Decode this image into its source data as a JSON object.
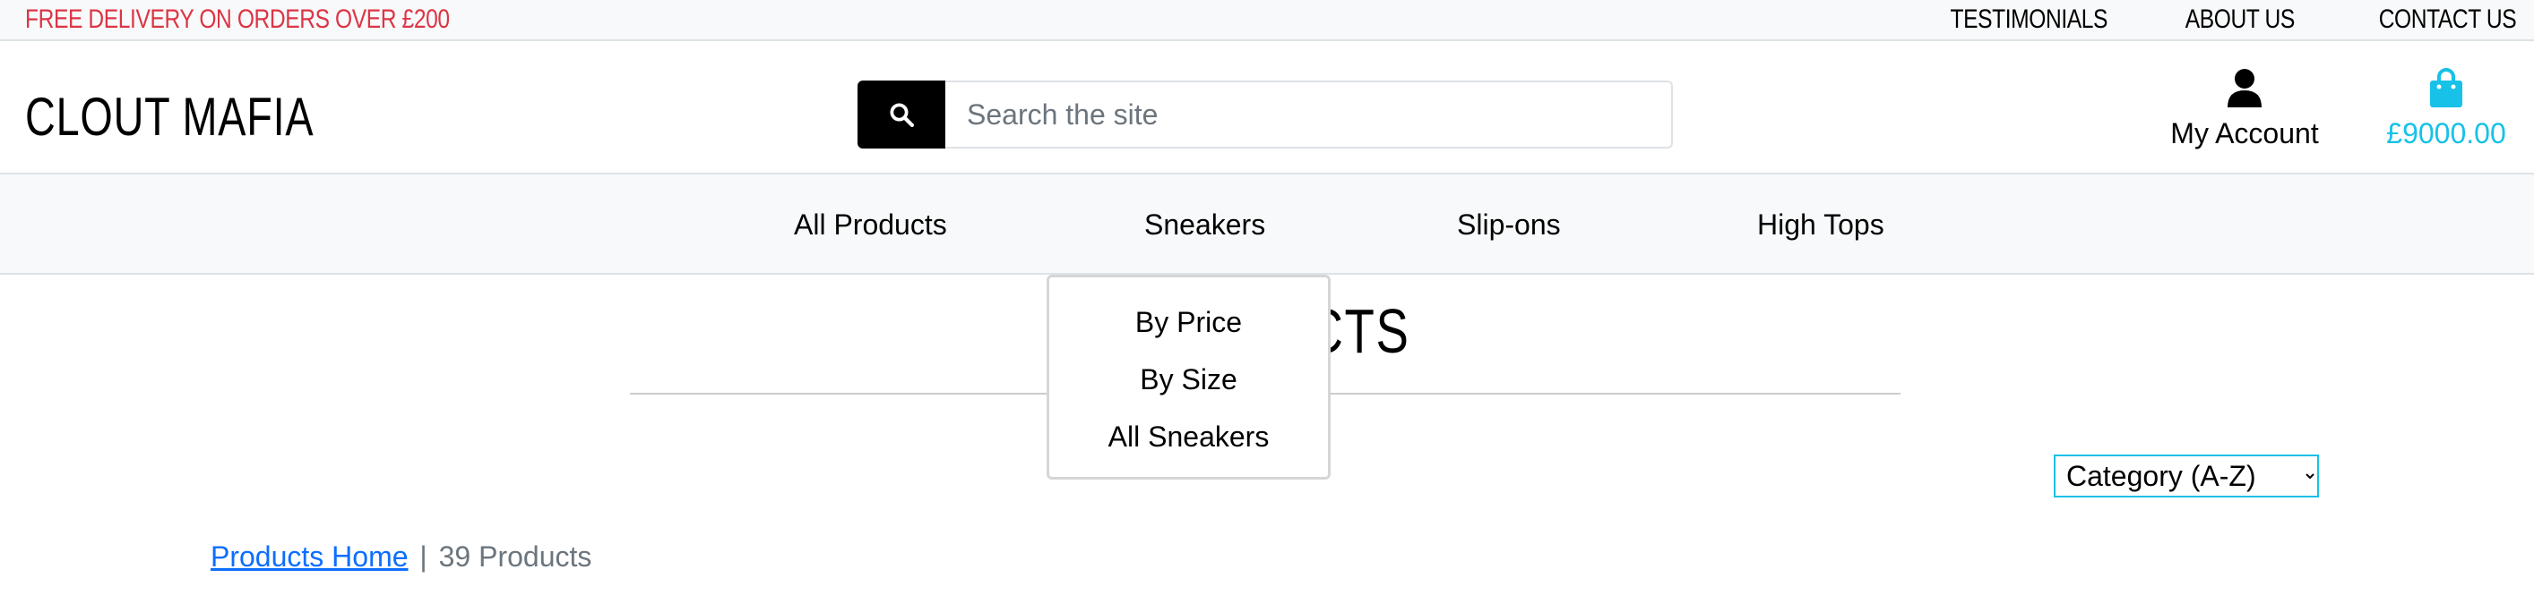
{
  "topbar": {
    "promo": "FREE DELIVERY ON ORDERS OVER £200",
    "links": [
      "TESTIMONIALS",
      "ABOUT US",
      "CONTACT US"
    ]
  },
  "header": {
    "logo": "CLOUT MAFIA",
    "search": {
      "placeholder": "Search the site",
      "icon": "search-icon"
    },
    "account": {
      "label": "My Account",
      "icon": "user-icon"
    },
    "cart": {
      "label": "£9000.00",
      "icon": "shopping-bag-icon",
      "color": "#17c1e8"
    }
  },
  "nav": {
    "items": [
      "All Products",
      "Sneakers",
      "Slip-ons",
      "High Tops"
    ]
  },
  "dropdown": {
    "items": [
      "By Price",
      "By Size",
      "All Sneakers"
    ]
  },
  "page": {
    "title": "PRODUCTS",
    "sort_selected": "Category (A-Z)",
    "breadcrumb_link": "Products Home",
    "separator": "|",
    "count": "39 Products"
  },
  "colors": {
    "promo": "#dc3545",
    "accent": "#17c1e8",
    "link": "#0d6efd"
  }
}
